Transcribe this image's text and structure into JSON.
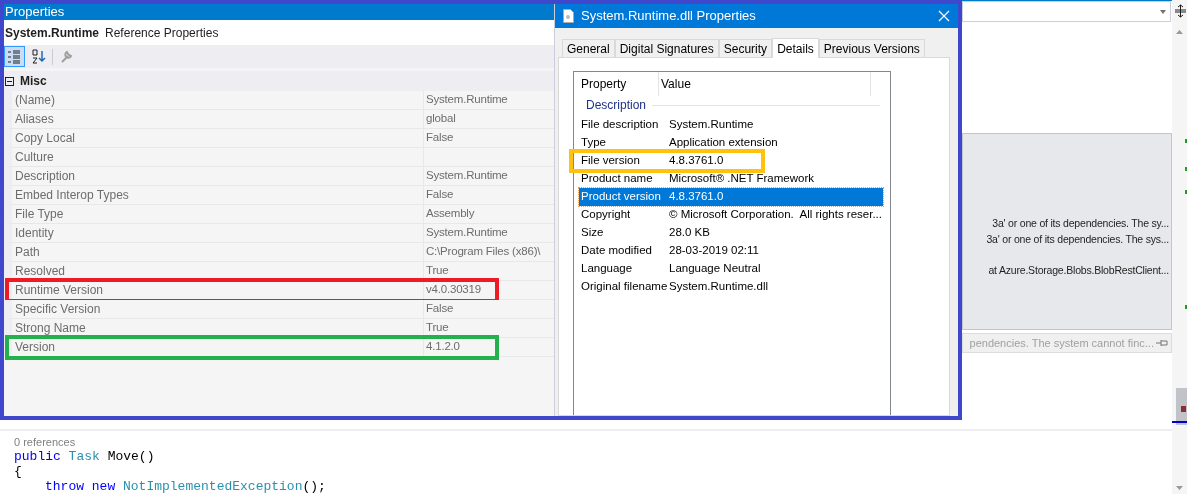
{
  "properties_panel": {
    "title": "Properties",
    "object_name": "System.Runtime",
    "object_type": "Reference Properties",
    "toolbar": [
      {
        "kind": "categorized",
        "selected": true
      },
      {
        "kind": "alphabetical",
        "selected": false
      },
      {
        "kind": "property-pages",
        "selected": false
      }
    ],
    "category": {
      "label": "Misc",
      "expanded": true
    },
    "rows": [
      {
        "name": "(Name)",
        "value": "System.Runtime"
      },
      {
        "name": "Aliases",
        "value": "global"
      },
      {
        "name": "Copy Local",
        "value": "False"
      },
      {
        "name": "Culture"
      },
      {
        "name": "Description",
        "value": "System.Runtime"
      },
      {
        "name": "Embed Interop Types",
        "value": "False"
      },
      {
        "name": "File Type",
        "value": "Assembly"
      },
      {
        "name": "Identity",
        "value": "System.Runtime"
      },
      {
        "name": "Path",
        "value": "C:\\Program Files (x86)\\"
      },
      {
        "name": "Resolved",
        "value": "True"
      },
      {
        "name": "Runtime Version",
        "value": "v4.0.30319",
        "color": "#ed1c24"
      },
      {
        "name": "Specific Version",
        "value": "False"
      },
      {
        "name": "Strong Name",
        "value": "True"
      },
      {
        "name": "Version",
        "value": "4.1.2.0",
        "color": "#22b14c"
      }
    ]
  },
  "file_dialog": {
    "title": "System.Runtime.dll Properties",
    "tabs": [
      {
        "label": "General",
        "selected": false
      },
      {
        "label": "Digital Signatures",
        "selected": false
      },
      {
        "label": "Security",
        "selected": false
      },
      {
        "label": "Details",
        "selected": true
      },
      {
        "label": "Previous Versions",
        "selected": false
      }
    ],
    "columns": [
      "Property",
      "Value"
    ],
    "group": "Description",
    "rows": [
      {
        "property": "File description",
        "value": "System.Runtime",
        "selected": false
      },
      {
        "property": "Type",
        "value": "Application extension",
        "selected": false
      },
      {
        "property": "File version",
        "value": "4.8.3761.0",
        "selected": false,
        "color": "#ffc20e"
      },
      {
        "property": "Product name",
        "value": "Microsoft® .NET Framework",
        "selected": false
      },
      {
        "property": "Product version",
        "value": "4.8.3761.0",
        "selected": true
      },
      {
        "property": "Copyright",
        "value": "© Microsoft Corporation.  All rights reser...",
        "selected": false
      },
      {
        "property": "Size",
        "value": "28.0 KB",
        "selected": false
      },
      {
        "property": "Date modified",
        "value": "28-03-2019 02:11",
        "selected": false
      },
      {
        "property": "Language",
        "value": "Language Neutral",
        "selected": false
      },
      {
        "property": "Original filename",
        "value": "System.Runtime.dll",
        "selected": false
      }
    ]
  },
  "editor": {
    "error_tooltip": [
      "3a' or one of its dependencies. The sy...",
      "3a' or one of its dependencies. The sys...",
      "at Azure.Storage.Blobs.BlobRestClient..."
    ],
    "error_summary": "pendencies. The system cannot finc...",
    "codelens": "0 references",
    "code_lines": [
      {
        "indented": false,
        "tokens": [
          {
            "kind": "keyword",
            "text": "public "
          },
          {
            "kind": "type",
            "text": "Task "
          },
          {
            "kind": "plain",
            "text": "Move()"
          }
        ]
      },
      {
        "indented": false,
        "tokens": [
          {
            "kind": "plain",
            "text": "{"
          }
        ]
      },
      {
        "indented": true,
        "tokens": [
          {
            "kind": "keyword",
            "text": "throw new "
          },
          {
            "kind": "type",
            "text": "NotImplementedException"
          },
          {
            "kind": "plain",
            "text": "();"
          }
        ]
      }
    ]
  }
}
